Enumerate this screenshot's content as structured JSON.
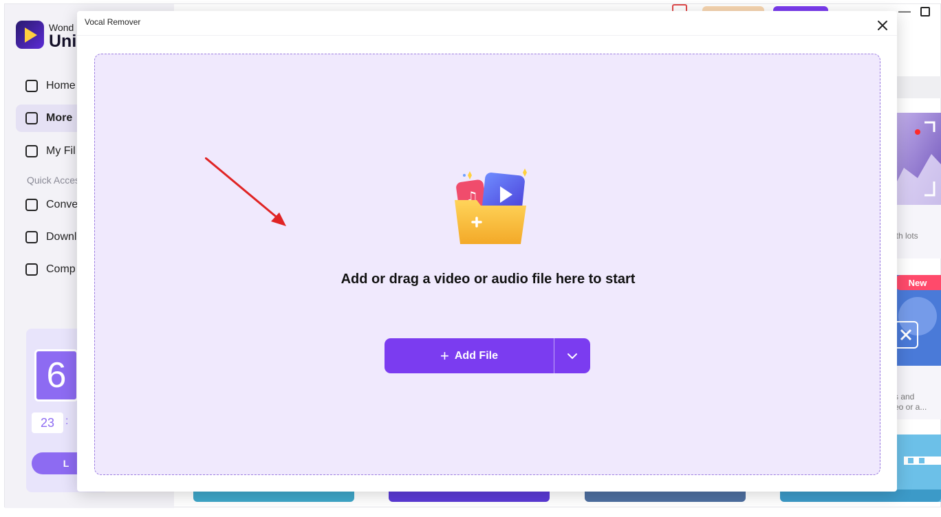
{
  "background_app": {
    "brand_top": "Wond",
    "brand_main": "Uni",
    "nav": [
      {
        "label": "Home",
        "icon": "home-icon"
      },
      {
        "label": "More",
        "icon": "toolbox-icon"
      },
      {
        "label": "My Fil",
        "icon": "file-icon"
      }
    ],
    "quick_access_label": "Quick Acces",
    "quick_access": [
      {
        "label": "Conve",
        "icon": "convert-icon"
      },
      {
        "label": "Downl",
        "icon": "download-icon"
      },
      {
        "label": "Comp",
        "icon": "compress-icon"
      }
    ],
    "promo": {
      "digit": "6",
      "time": "23",
      "colon": ":",
      "button": "L"
    },
    "right_cards": {
      "card1_text": "ith lots",
      "new_badge": "New",
      "card2_text_line1": "s and",
      "card2_text_line2": "eo or a..."
    }
  },
  "modal": {
    "title": "Vocal Remover",
    "close_icon": "close-icon",
    "drop_text": "Add or drag a video or audio file here to start",
    "add_file_label": "Add File",
    "dropdown_icon": "chevron-down-icon"
  },
  "colors": {
    "accent": "#7b3cf0",
    "drop_zone_bg": "#f0e9fd",
    "drop_zone_border": "#9a7be0",
    "arrow": "#e02424"
  }
}
